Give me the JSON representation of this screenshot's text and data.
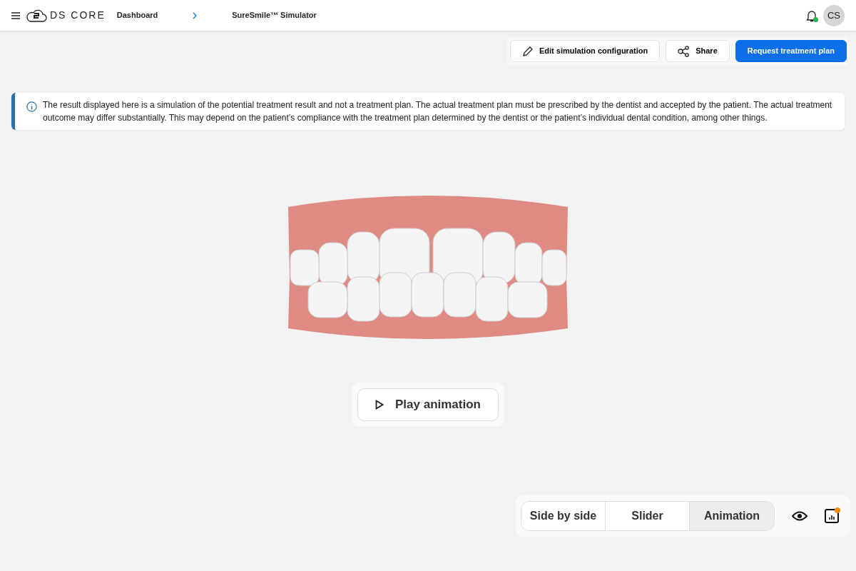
{
  "header": {
    "logo_text": "DS CORE",
    "breadcrumbs": [
      "Dashboard",
      "SureSmile™ Simulator"
    ],
    "avatar": "CS",
    "notification_dot": true
  },
  "actions": [
    {
      "kind": "edit",
      "label": "Edit simulation configuration"
    },
    {
      "kind": "share",
      "label": "Share"
    },
    {
      "kind": "primary",
      "label": "Request treatment plan"
    }
  ],
  "notice": "The result displayed here is a simulation of the potential treatment result and not a treatment plan. The actual treatment plan must be prescribed by the dentist and accepted by the patient. The actual treatment outcome may differ substantially. This may depend on the patient’s compliance with the treatment plan determined by the dentist or the patient’s individual dental condition, among other things.",
  "play_button": "Play animation",
  "view_modes": [
    {
      "label": "Side by side",
      "selected": false
    },
    {
      "label": "Slider",
      "selected": false
    },
    {
      "label": "Animation",
      "selected": true
    }
  ],
  "report_badge": true
}
